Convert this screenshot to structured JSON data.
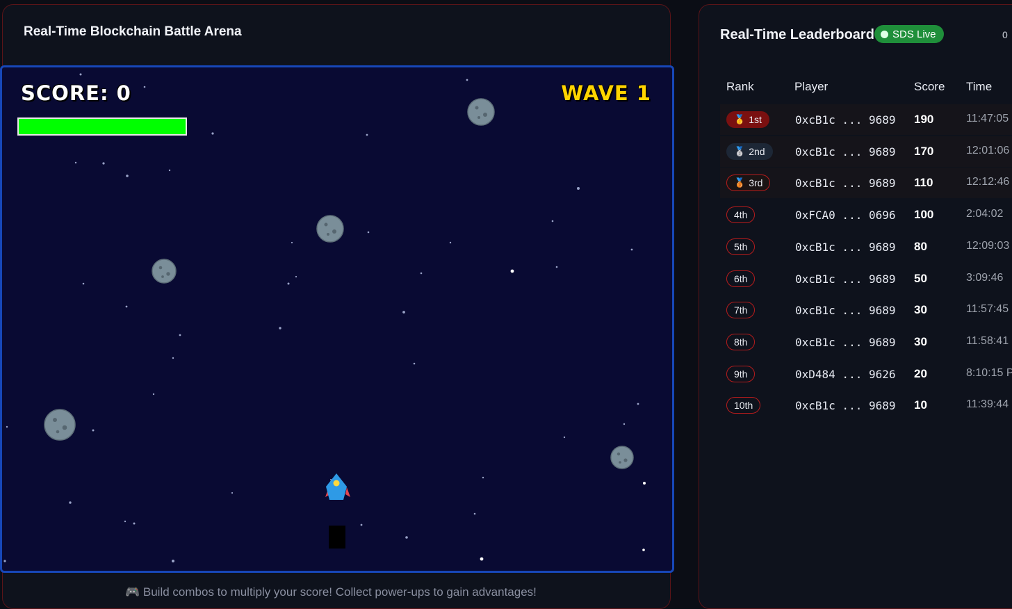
{
  "arena": {
    "title": "Real-Time Blockchain Battle Arena",
    "score_label": "SCORE: 0",
    "wave_label": "WAVE 1",
    "health_level": 1.0,
    "tip_text": "🎮 Build combos to multiply your score! Collect power-ups to gain advantages!"
  },
  "leaderboard": {
    "title": "Real-Time Leaderboard",
    "live_badge": "SDS Live",
    "count_text": "0",
    "headers": {
      "rank": "Rank",
      "player": "Player",
      "score": "Score",
      "time": "Time"
    },
    "rows": [
      {
        "rank": "1st",
        "medal": "gold-medal-icon",
        "player": "0xcB1c ... 9689",
        "score": "190",
        "time": "11:47:05"
      },
      {
        "rank": "2nd",
        "medal": "silver-medal-icon",
        "player": "0xcB1c ... 9689",
        "score": "170",
        "time": "12:01:06"
      },
      {
        "rank": "3rd",
        "medal": "bronze-medal-icon",
        "player": "0xcB1c ... 9689",
        "score": "110",
        "time": "12:12:46"
      },
      {
        "rank": "4th",
        "medal": "",
        "player": "0xFCA0 ... 0696",
        "score": "100",
        "time": "2:04:02"
      },
      {
        "rank": "5th",
        "medal": "",
        "player": "0xcB1c ... 9689",
        "score": "80",
        "time": "12:09:03"
      },
      {
        "rank": "6th",
        "medal": "",
        "player": "0xcB1c ... 9689",
        "score": "50",
        "time": "3:09:46"
      },
      {
        "rank": "7th",
        "medal": "",
        "player": "0xcB1c ... 9689",
        "score": "30",
        "time": "11:57:45"
      },
      {
        "rank": "8th",
        "medal": "",
        "player": "0xcB1c ... 9689",
        "score": "30",
        "time": "11:58:41"
      },
      {
        "rank": "9th",
        "medal": "",
        "player": "0xD484 ... 9626",
        "score": "20",
        "time": "8:10:15 P"
      },
      {
        "rank": "10th",
        "medal": "",
        "player": "0xcB1c ... 9689",
        "score": "10",
        "time": "11:39:44"
      }
    ]
  },
  "colors": {
    "panel_border": "#5a1418",
    "canvas_bg": "#090a33",
    "canvas_border": "#1747b8",
    "wave_text": "#ffd400",
    "health_fill": "#00ff00",
    "live_badge": "#1f8f3a",
    "rank_border": "#b71c1c"
  }
}
